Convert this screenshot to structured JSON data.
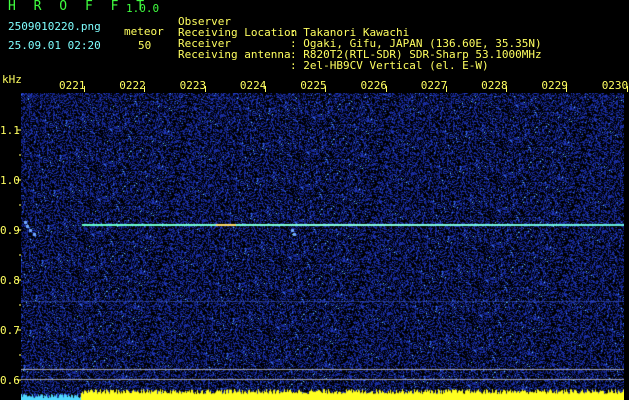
{
  "header": {
    "app_title": "H R O F F T",
    "version": "1.0.0",
    "filename": "2509010220.png",
    "mode": "meteor",
    "datetime": "25.09.01 02:20",
    "count": "50"
  },
  "station": [
    {
      "label": "Observer",
      "value": ": Takanori Kawachi"
    },
    {
      "label": "Receiving Location",
      "value": ": Ogaki, Gifu, JAPAN (136.60E, 35.35N)"
    },
    {
      "label": "Receiver",
      "value": ": R820T2(RTL-SDR) SDR-Sharp 53.1000MHz"
    },
    {
      "label": "Receiving antenna",
      "value": ": 2el-HB9CV Vertical (el. E-W)"
    }
  ],
  "axes": {
    "freq_unit": "kHz",
    "freq_ticks": [
      "1.1",
      "1.0",
      "0.9",
      "0.8",
      "0.7",
      "0.6"
    ],
    "time_ticks": [
      "0221",
      "0222",
      "0223",
      "0224",
      "0225",
      "0226",
      "0227",
      "0228",
      "0229",
      "0230"
    ]
  },
  "colors": {
    "background": "#000000",
    "noise": "#1c2c9a",
    "signal": "#7fffd4",
    "text_yellow": "#ffff60",
    "text_cyan": "#7fffff",
    "text_green": "#40ff40",
    "power_bar": "#ffff00"
  }
}
